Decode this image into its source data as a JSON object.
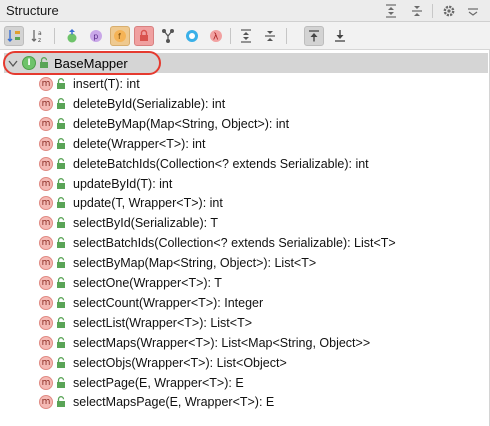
{
  "panel": {
    "title": "Structure"
  },
  "tree": {
    "root": {
      "name": "BaseMapper",
      "icon_letter": "I"
    },
    "methods": [
      {
        "signature": "insert(T): int",
        "icon_letter": "m"
      },
      {
        "signature": "deleteById(Serializable): int",
        "icon_letter": "m"
      },
      {
        "signature": "deleteByMap(Map<String, Object>): int",
        "icon_letter": "m"
      },
      {
        "signature": "delete(Wrapper<T>): int",
        "icon_letter": "m"
      },
      {
        "signature": "deleteBatchIds(Collection<? extends Serializable): int",
        "icon_letter": "m"
      },
      {
        "signature": "updateById(T): int",
        "icon_letter": "m"
      },
      {
        "signature": "update(T, Wrapper<T>): int",
        "icon_letter": "m"
      },
      {
        "signature": "selectById(Serializable): T",
        "icon_letter": "m"
      },
      {
        "signature": "selectBatchIds(Collection<? extends Serializable): List<T>",
        "icon_letter": "m"
      },
      {
        "signature": "selectByMap(Map<String, Object>): List<T>",
        "icon_letter": "m"
      },
      {
        "signature": "selectOne(Wrapper<T>): T",
        "icon_letter": "m"
      },
      {
        "signature": "selectCount(Wrapper<T>): Integer",
        "icon_letter": "m"
      },
      {
        "signature": "selectList(Wrapper<T>): List<T>",
        "icon_letter": "m"
      },
      {
        "signature": "selectMaps(Wrapper<T>): List<Map<String, Object>>",
        "icon_letter": "m"
      },
      {
        "signature": "selectObjs(Wrapper<T>): List<Object>",
        "icon_letter": "m"
      },
      {
        "signature": "selectPage(E, Wrapper<T>): E",
        "icon_letter": "m"
      },
      {
        "signature": "selectMapsPage(E, Wrapper<T>): E",
        "icon_letter": "m"
      }
    ]
  },
  "icons": {
    "header": [
      "expand-all-icon",
      "collapse-all-icon",
      "settings-gear-icon",
      "hide-panel-icon"
    ],
    "toolbar": [
      "sort-by-visibility-icon",
      "sort-alphabetically-icon",
      "show-inherited-icon",
      "show-properties-icon",
      "show-fields-icon",
      "show-non-public-icon",
      "show-anonymous-classes-icon",
      "show-lambdas-icon",
      "show-lambda-icon",
      "expand-all-icon",
      "collapse-all-icon",
      "autoscroll-to-source-icon",
      "autoscroll-from-source-icon"
    ]
  },
  "colors": {
    "selection": "#d5d5d5",
    "highlight_outline": "#e53a2f",
    "method_icon": "#f4b9b4",
    "interface_icon": "#6ec36a"
  }
}
